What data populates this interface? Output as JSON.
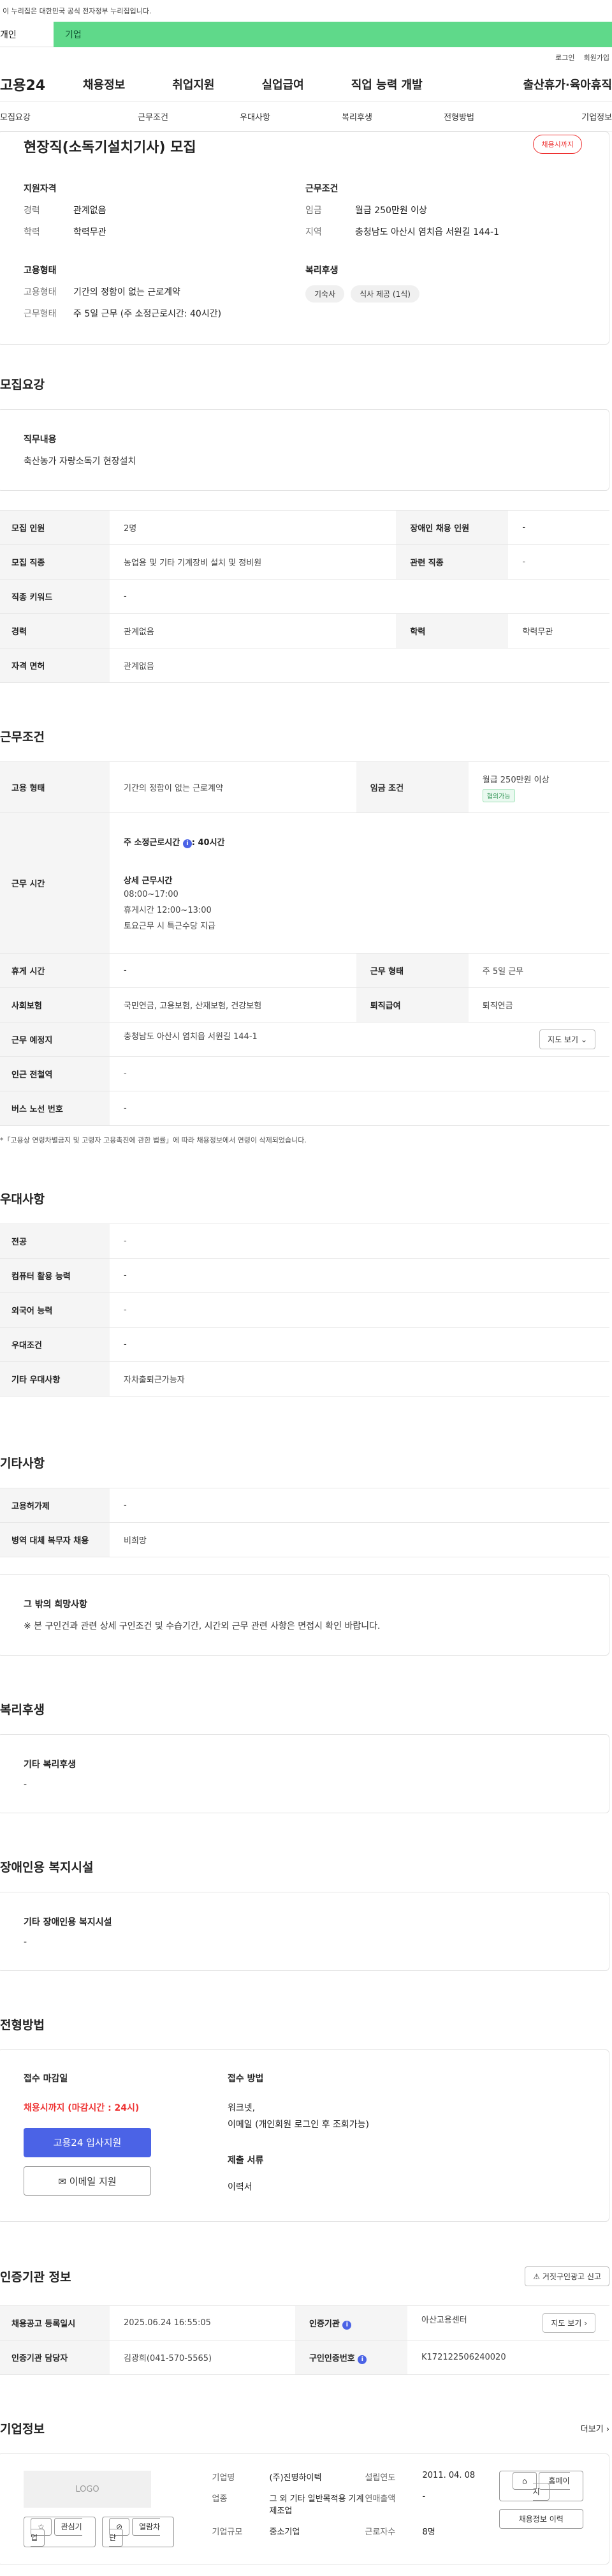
{
  "gov_bar": "이 누리집은 대한민국 공식 전자정부 누리집입니다.",
  "tabs": [
    "개인",
    "기업"
  ],
  "util": [
    "로그인",
    "회원가입"
  ],
  "gnb": {
    "logo": "고용24",
    "items": [
      "채용정보",
      "취업지원",
      "실업급여",
      "직업 능력 개발",
      "출산휴가·육아휴직"
    ]
  },
  "subnav": [
    "모집요강",
    "근무조건",
    "우대사항",
    "복리후생",
    "전형방법",
    "기업정보"
  ],
  "header": {
    "title": "현장직(소독기설치기사) 모집",
    "badge": "채용시까지"
  },
  "summary": {
    "qual_title": "지원자격",
    "qual": [
      {
        "k": "경력",
        "v": "관계없음"
      },
      {
        "k": "학력",
        "v": "학력무관"
      }
    ],
    "emp_title": "고용형태",
    "emp": [
      {
        "k": "고용형태",
        "v": "기간의 정함이 없는 근로계약"
      },
      {
        "k": "근무형태",
        "v": "주 5일 근무 (주 소정근로시간: 40시간)"
      }
    ],
    "work_title": "근무조건",
    "work": [
      {
        "k": "임금",
        "v": "월급 250만원 이상"
      },
      {
        "k": "지역",
        "v": "충청남도 아산시 염치읍 서원길 144-1"
      }
    ],
    "welfare_title": "복리후생",
    "welfare": [
      "기숙사",
      "식사 제공 (1식)"
    ]
  },
  "recruit": {
    "title": "모집요강",
    "duty_title": "직무내용",
    "duty": "축산농가 자량소독기 현장설치",
    "rows": [
      [
        "모집 인원",
        "2명",
        "장애인 채용 인원",
        "-"
      ],
      [
        "모집 직종",
        "농업용 및 기타 기계장비 설치 및 정비원",
        "관련 직종",
        "-"
      ],
      [
        "직종 키워드",
        "-",
        "",
        ""
      ],
      [
        "경력",
        "관계없음",
        "학력",
        "학력무관"
      ],
      [
        "자격 면허",
        "관계없음",
        "",
        ""
      ]
    ]
  },
  "work": {
    "title": "근무조건",
    "type_k": "고용 형태",
    "type_v": "기간의 정함이 없는 근로계약",
    "wage_k": "임금 조건",
    "wage_v": "월급 250만원 이상",
    "wage_tag": "협의가능",
    "hours_k": "근무 시간",
    "hours_main": "주 소정근로시간",
    "hours_val": ": 40시간",
    "hours_detail_title": "상세 근무시간",
    "hours_lines": [
      "08:00~17:00",
      "휴게시간 12:00~13:00",
      "토요근무 시 특근수당 지급"
    ],
    "leave_k": "휴게 시간",
    "leave_v": "-",
    "shift_k": "근무 형태",
    "shift_v": "주 5일 근무",
    "ins_k": "사회보험",
    "ins_v": "국민연금, 고용보험, 산재보험, 건강보험",
    "retire_k": "퇴직급여",
    "retire_v": "퇴직연금",
    "place_k": "근무 예정지",
    "place_v": "충청남도 아산시 염치읍 서원길 144-1",
    "map_btn": "지도 보기",
    "station_k": "인근 전철역",
    "station_v": "-",
    "bus_k": "버스 노선 번호",
    "bus_v": "-",
    "note": "*「고용상 연령차별금지 및 고령자 고용촉진에 관한 법률」에 따라 채용정보에서 연령이 삭제되었습니다."
  },
  "pref": {
    "title": "우대사항",
    "rows": [
      [
        "전공",
        "-"
      ],
      [
        "컴퓨터 활용 능력",
        "-"
      ],
      [
        "외국어 능력",
        "-"
      ],
      [
        "우대조건",
        "-"
      ],
      [
        "기타 우대사항",
        "자차출퇴근가능자"
      ]
    ]
  },
  "etc": {
    "title": "기타사항",
    "rows": [
      [
        "고용허가제",
        "-"
      ],
      [
        "병역 대체 복무자 채용",
        "비희망"
      ]
    ],
    "msg_title": "그 밖의 희망사항",
    "msg": "※ 본 구인건과 관련 상세 구인조건 및 수습기간, 시간외 근무 관련 사항은 면접시 확인 바랍니다."
  },
  "welfare": {
    "title": "복리후생",
    "sub": "기타 복리후생",
    "val": "-"
  },
  "disabled": {
    "title": "장애인용 복지시설",
    "sub": "기타 장애인용 복지시설",
    "val": "-"
  },
  "process": {
    "title": "전형방법",
    "deadline_title": "접수 마감일",
    "deadline": "채용시까지 (마감시간 : 24시)",
    "apply_btn": "고용24 입사지원",
    "email_btn": "이메일 지원",
    "method_title": "접수 방법",
    "method": "워크넷,",
    "method2": "이메일 (개인회원 로그인 후 조회가능)",
    "docs_title": "제출 서류",
    "docs": "이력서"
  },
  "cert": {
    "title": "인증기관 정보",
    "report_btn": "거짓구인광고 신고",
    "r1": [
      "채용공고 등록일시",
      "2025.06.24 16:55:05",
      "인증기관",
      "아산고용센터"
    ],
    "map_btn": "지도 보기",
    "r2": [
      "인증기관 담당자",
      "김광희(041-570-5565)",
      "구인인증번호",
      "K172122506240020"
    ]
  },
  "company": {
    "title": "기업정보",
    "more": "더보기",
    "logo": "LOGO",
    "fav": "관심기업",
    "block": "열람차단",
    "info": [
      [
        "기업명",
        "(주)진명하이텍",
        "설립연도",
        "2011. 04. 08"
      ],
      [
        "업종",
        "그 외 기타 일반목적용 기계 제조업",
        "연매출액",
        "-"
      ],
      [
        "기업규모",
        "중소기업",
        "근로자수",
        "8명"
      ]
    ],
    "home_btn": "홈페이지",
    "history_btn": "채용정보 이력"
  }
}
